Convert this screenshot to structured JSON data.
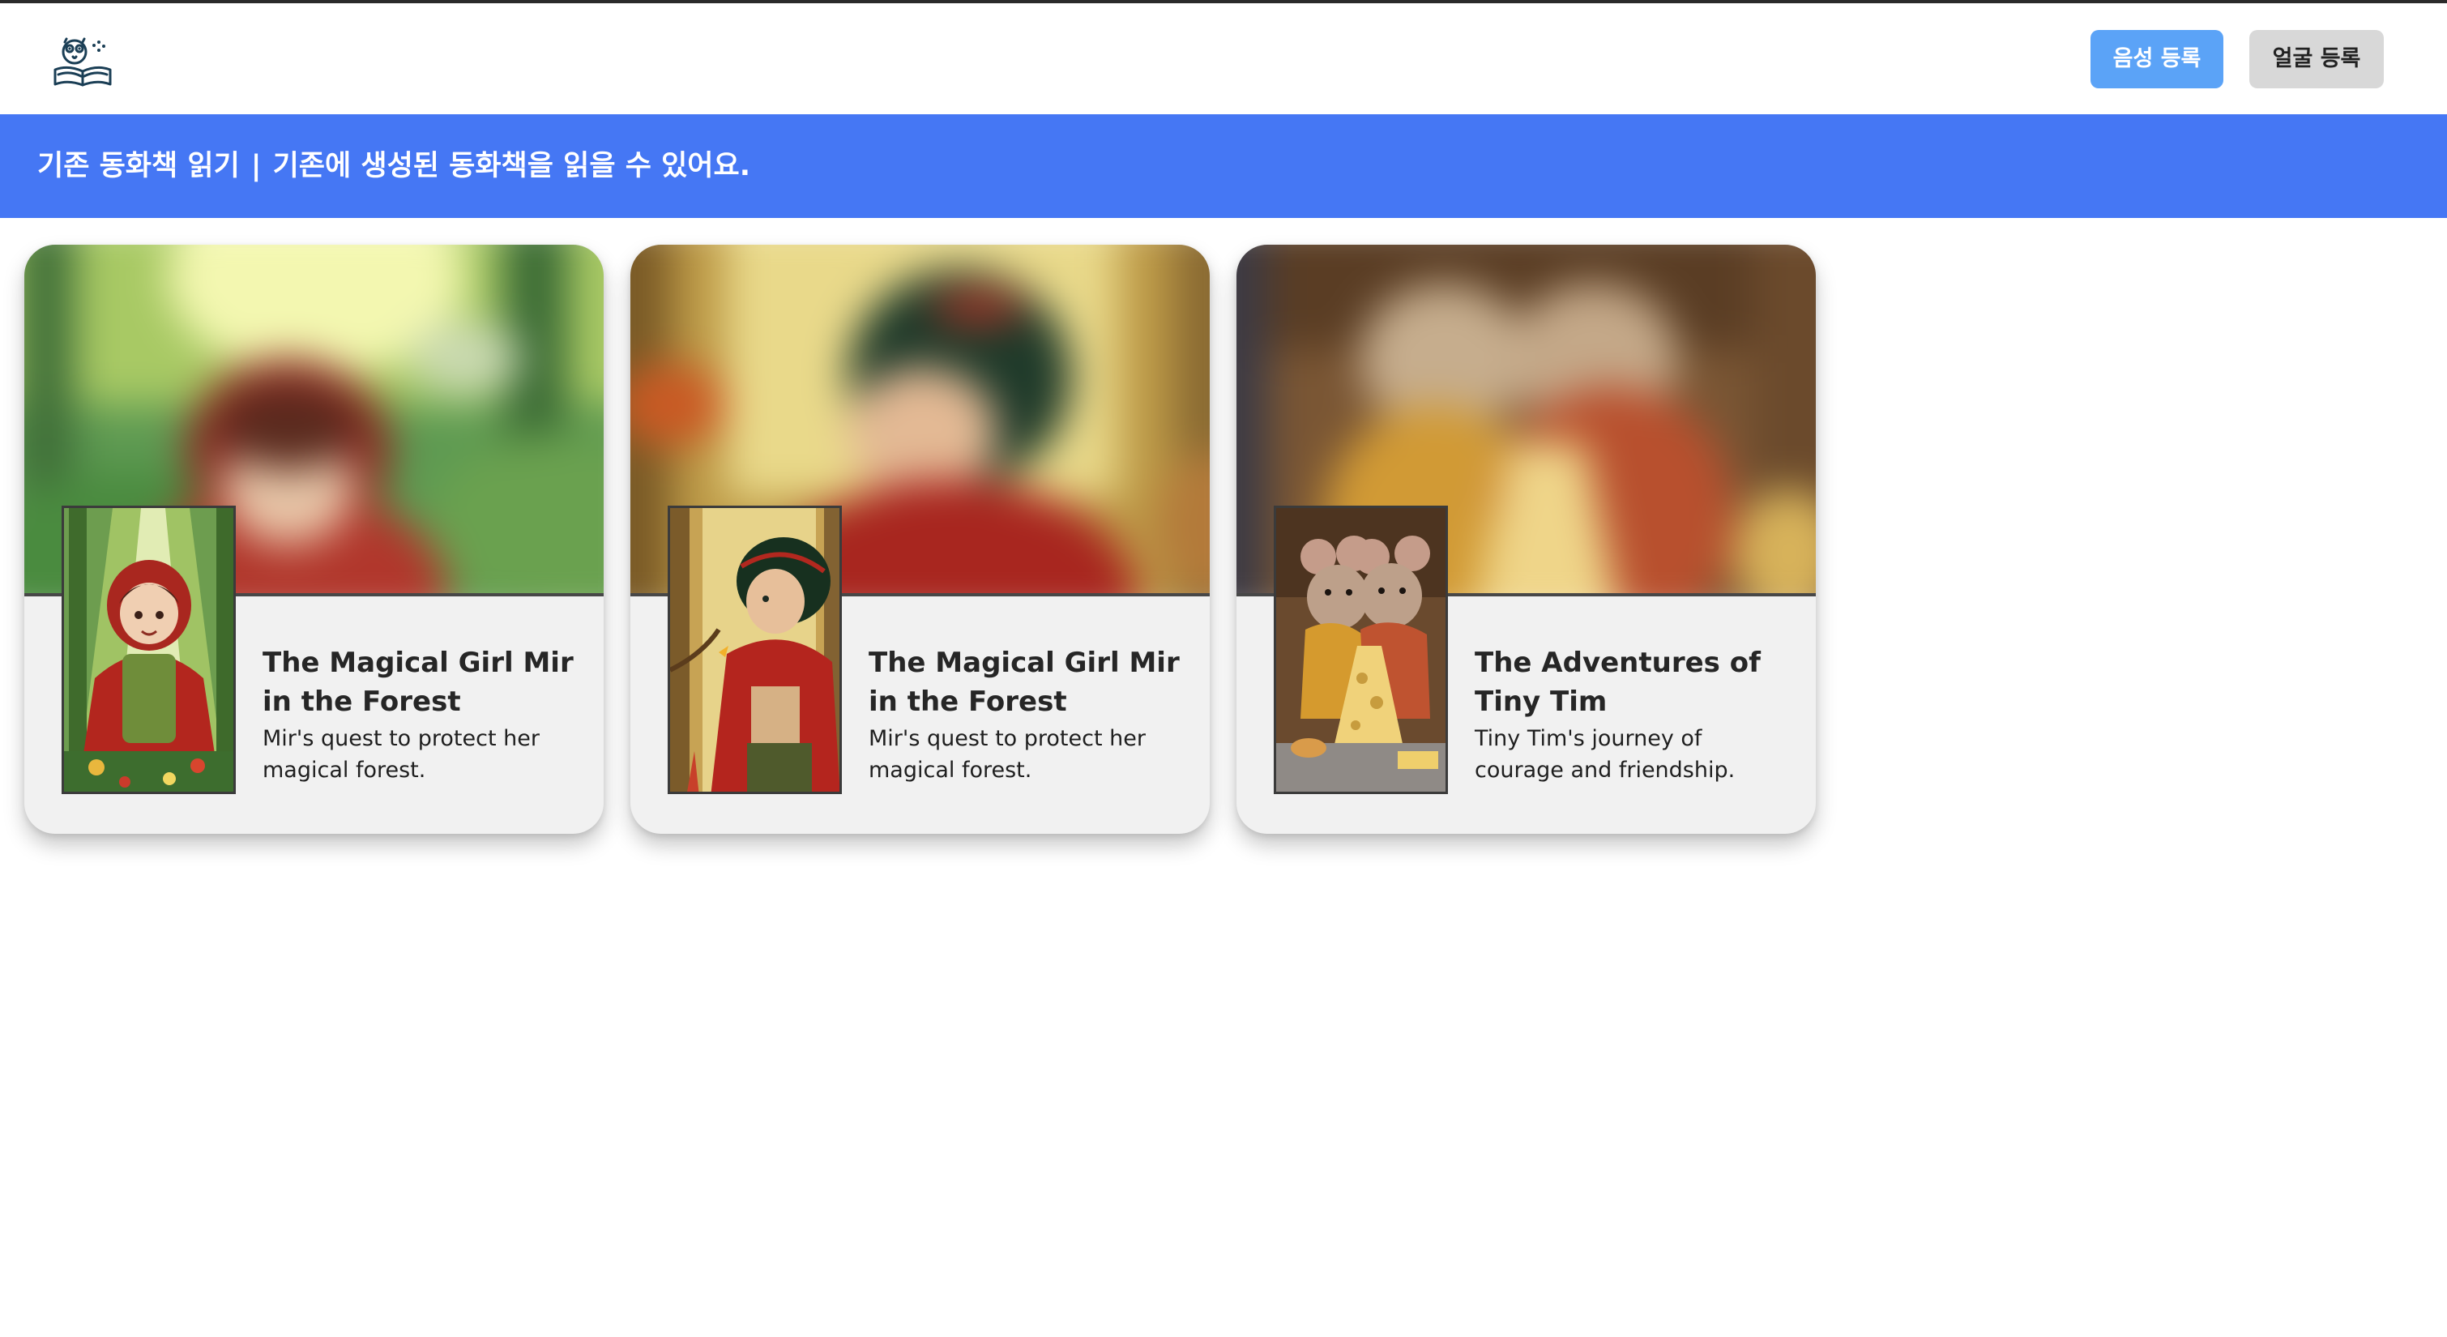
{
  "header": {
    "logo_icon": "book-owl-logo-icon",
    "voice_button_label": "음성 등록",
    "face_button_label": "얼굴 등록"
  },
  "banner": {
    "section_title": "기존 동화책 읽기",
    "separator": "|",
    "description": "기존에 생성된 동화책을 읽을 수 있어요."
  },
  "books": [
    {
      "title": "The Magical Girl Mir in the Forest",
      "description": "Mir's quest to protect her magical forest."
    },
    {
      "title": "The Magical Girl Mir in the Forest",
      "description": "Mir's quest to protect her magical forest."
    },
    {
      "title": "The Adventures of Tiny Tim",
      "description": "Tiny Tim's journey of courage and friendship."
    }
  ],
  "colors": {
    "banner": "#4577f4",
    "voice_button": "#5ba3f7",
    "face_button": "#d8d8d8",
    "card_background": "#f1f1f1"
  }
}
